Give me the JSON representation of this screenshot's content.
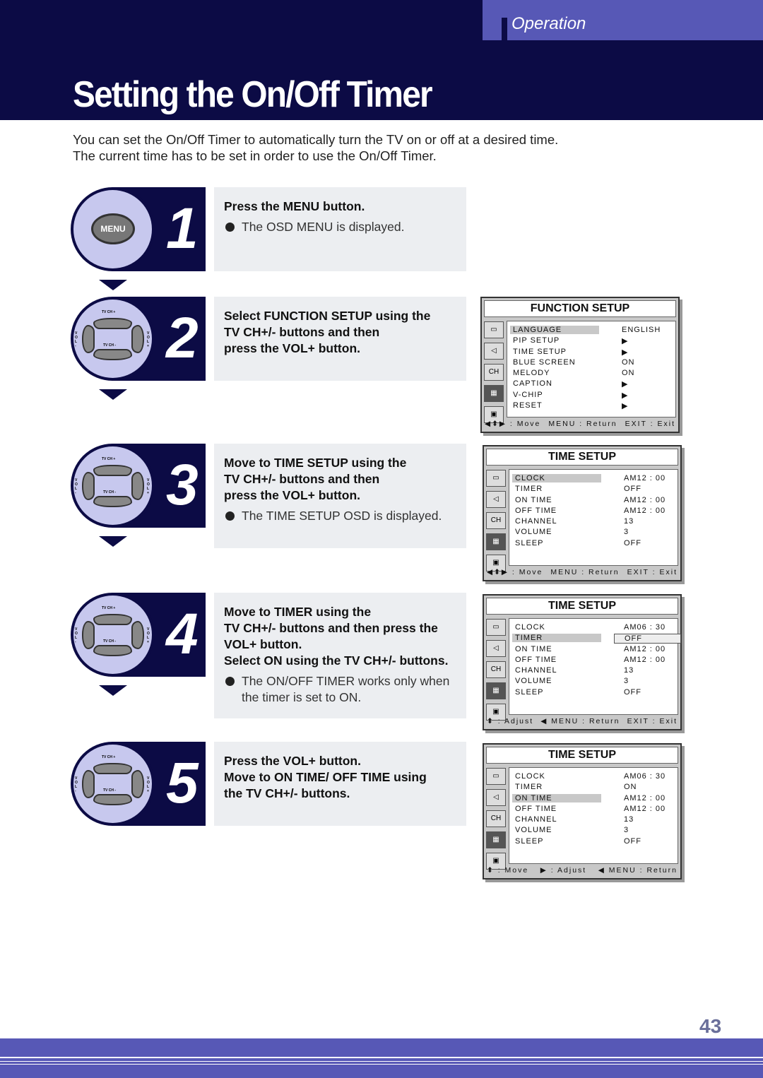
{
  "header": {
    "section": "Operation",
    "title": "Setting the On/Off Timer"
  },
  "intro": [
    "You can set the On/Off Timer to automatically turn the TV on or off at a desired time.",
    "The current time has to be set in order to use the On/Off Timer."
  ],
  "colors": {
    "navy": "#0c0b45",
    "accent": "#5758b6",
    "badge_circle": "#c7c8ee",
    "step_bg": "#eceef1"
  },
  "remote_labels": {
    "menu": "MENU",
    "ch_up": "TV CH +",
    "ch_down": "TV CH -",
    "vol_minus": "VOL -",
    "vol_plus": "VOL +"
  },
  "steps": [
    {
      "number": "1",
      "icon": "menu-button-icon",
      "lines": [
        "Press the MENU button."
      ],
      "bullets": [
        "The OSD MENU is displayed."
      ]
    },
    {
      "number": "2",
      "icon": "remote-dpad-icon",
      "lines": [
        "Select FUNCTION SETUP using the",
        "TV CH+/- buttons and then",
        "press the VOL+ button."
      ],
      "bullets": []
    },
    {
      "number": "3",
      "icon": "remote-dpad-icon",
      "lines": [
        "Move to TIME SETUP using the",
        "TV CH+/- buttons and then",
        "press the VOL+ button."
      ],
      "bullets": [
        "The TIME SETUP OSD is displayed."
      ]
    },
    {
      "number": "4",
      "icon": "remote-dpad-icon",
      "lines": [
        "Move to TIMER using the",
        "TV CH+/- buttons and then press the",
        "VOL+ button.",
        "Select ON using the TV CH+/- buttons."
      ],
      "bullets": [
        "The ON/OFF TIMER works only when the timer is set to ON."
      ]
    },
    {
      "number": "5",
      "icon": "remote-dpad-icon",
      "lines": [
        "Press the VOL+ button.",
        "Move to ON TIME/ OFF TIME using",
        "the TV CH+/- buttons."
      ],
      "bullets": []
    }
  ],
  "osd": [
    {
      "title": "FUNCTION SETUP",
      "highlight": 0,
      "value_box": -1,
      "rows": [
        [
          "LANGUAGE",
          "ENGLISH"
        ],
        [
          "PIP SETUP",
          "▶"
        ],
        [
          "TIME SETUP",
          "▶"
        ],
        [
          "BLUE SCREEN",
          "ON"
        ],
        [
          "MELODY",
          "ON"
        ],
        [
          "CAPTION",
          "▶"
        ],
        [
          "V-CHIP",
          "▶"
        ],
        [
          "RESET",
          "▶"
        ]
      ],
      "footer": [
        "◀⬍▶ : Move",
        "MENU : Return",
        "EXIT : Exit"
      ]
    },
    {
      "title": "TIME SETUP",
      "highlight": 0,
      "value_box": -1,
      "rows": [
        [
          "CLOCK",
          "AM12 : 00"
        ],
        [
          "TIMER",
          "OFF"
        ],
        [
          "ON TIME",
          "AM12 : 00"
        ],
        [
          "OFF TIME",
          "AM12 : 00"
        ],
        [
          "CHANNEL",
          "13"
        ],
        [
          "VOLUME",
          "3"
        ],
        [
          "SLEEP",
          "OFF"
        ]
      ],
      "footer": [
        "◀⬍▶ : Move",
        "MENU : Return",
        "EXIT : Exit"
      ]
    },
    {
      "title": "TIME SETUP",
      "highlight": 1,
      "value_box": 1,
      "rows": [
        [
          "CLOCK",
          "AM06 : 30"
        ],
        [
          "TIMER",
          "OFF"
        ],
        [
          "ON TIME",
          "AM12 : 00"
        ],
        [
          "OFF TIME",
          "AM12 : 00"
        ],
        [
          "CHANNEL",
          "13"
        ],
        [
          "VOLUME",
          "3"
        ],
        [
          "SLEEP",
          "OFF"
        ]
      ],
      "footer": [
        "⬍ : Adjust",
        "◀ MENU : Return",
        "EXIT : Exit"
      ]
    },
    {
      "title": "TIME SETUP",
      "highlight": 2,
      "value_box": -1,
      "rows": [
        [
          "CLOCK",
          "AM06 : 30"
        ],
        [
          "TIMER",
          "ON"
        ],
        [
          "ON TIME",
          "AM12 : 00"
        ],
        [
          "OFF TIME",
          "AM12 : 00"
        ],
        [
          "CHANNEL",
          "13"
        ],
        [
          "VOLUME",
          "3"
        ],
        [
          "SLEEP",
          "OFF"
        ]
      ],
      "footer": [
        "⬍ : Move",
        "▶ : Adjust",
        "◀ MENU : Return"
      ]
    }
  ],
  "page_number": "43"
}
